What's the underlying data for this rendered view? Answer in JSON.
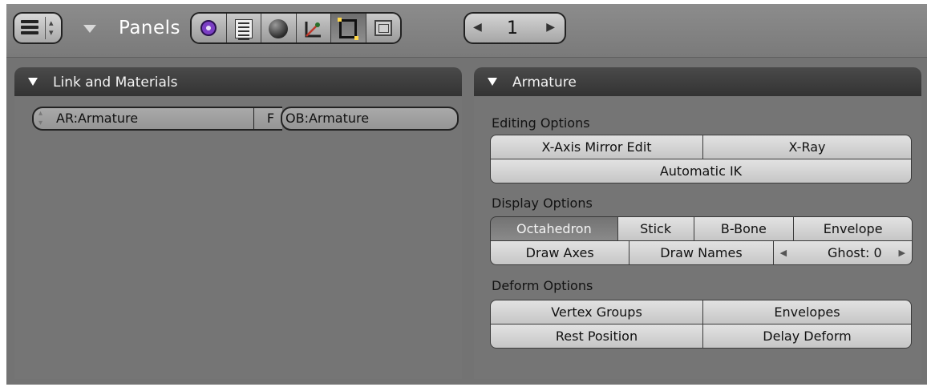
{
  "header": {
    "panels_label": "Panels",
    "context_buttons": [
      {
        "icon": "logic-icon",
        "active": false
      },
      {
        "icon": "script-icon",
        "active": false
      },
      {
        "icon": "shading-icon",
        "active": false
      },
      {
        "icon": "object-icon",
        "active": false
      },
      {
        "icon": "editing-icon",
        "active": true
      },
      {
        "icon": "scene-icon",
        "active": false
      }
    ],
    "pager": {
      "left_arrow": "◀",
      "value": "1",
      "right_arrow": "▶"
    }
  },
  "link_panel": {
    "title": "Link and Materials",
    "armature_datablock": "AR:Armature",
    "fake_user": "F",
    "object_name": "OB:Armature"
  },
  "armature_panel": {
    "title": "Armature",
    "editing_label": "Editing Options",
    "editing": {
      "xaxis_mirror": "X-Axis Mirror Edit",
      "xray": "X-Ray",
      "auto_ik": "Automatic IK"
    },
    "display_label": "Display Options",
    "display": {
      "octahedron": "Octahedron",
      "stick": "Stick",
      "bbone": "B-Bone",
      "envelope": "Envelope",
      "draw_axes": "Draw Axes",
      "draw_names": "Draw Names",
      "ghost": "Ghost: 0",
      "selected": "Octahedron"
    },
    "deform_label": "Deform Options",
    "deform": {
      "vertex_groups": "Vertex Groups",
      "envelopes": "Envelopes",
      "rest_position": "Rest Position",
      "delay_deform": "Delay Deform"
    }
  },
  "colors": {
    "panel_bg": "#757575",
    "header_bg": "#3b3b3b",
    "button": "#d4d4d4",
    "selected": "#7d7d7d"
  }
}
